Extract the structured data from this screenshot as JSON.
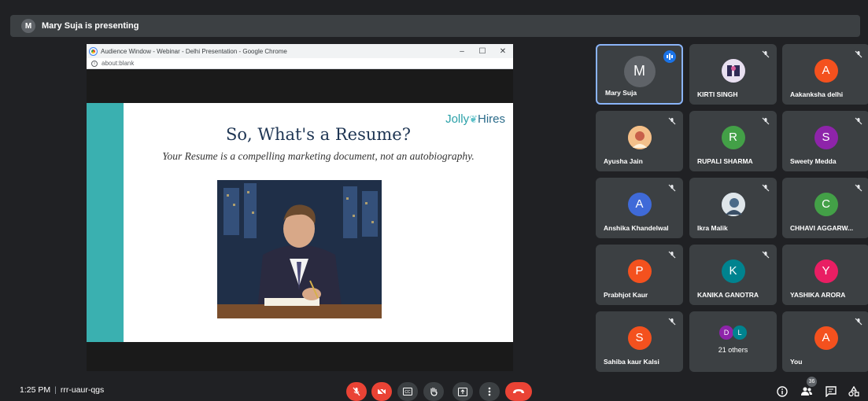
{
  "presenting": {
    "initial": "M",
    "text": "Mary Suja is presenting"
  },
  "browser": {
    "title": "Audience Window - Webinar - Delhi Presentation - Google Chrome",
    "address": "about:blank",
    "minimize": "–",
    "maximize": "☐",
    "close": "✕"
  },
  "slide": {
    "brand_jolly": "Jolly",
    "brand_hires": "Hires",
    "title": "So, What's a Resume?",
    "subtitle": "Your Resume is a compelling marketing document, not an autobiography."
  },
  "participants": [
    {
      "name": "Mary Suja",
      "initial": "M",
      "color": "#5f6368"
    },
    {
      "name": "KIRTI SINGH",
      "initial": "",
      "color": "#7a5c8f"
    },
    {
      "name": "Aakanksha delhi",
      "initial": "A",
      "color": "#f4511e"
    },
    {
      "name": "Ayusha Jain",
      "initial": "",
      "color": "#e08a3c"
    },
    {
      "name": "RUPALI SHARMA",
      "initial": "R",
      "color": "#43a047"
    },
    {
      "name": "Sweety Medda",
      "initial": "S",
      "color": "#8e24aa"
    },
    {
      "name": "Anshika Khandelwal",
      "initial": "A",
      "color": "#3f6ad8"
    },
    {
      "name": "Ikra Malik",
      "initial": "",
      "color": "#6a8ca8"
    },
    {
      "name": "CHHAVI AGGARW...",
      "initial": "C",
      "color": "#43a047"
    },
    {
      "name": "Prabhjot Kaur",
      "initial": "P",
      "color": "#f4511e"
    },
    {
      "name": "KANIKA GANOTRA",
      "initial": "K",
      "color": "#00838f"
    },
    {
      "name": "YASHIKA ARORA",
      "initial": "Y",
      "color": "#e91e63"
    },
    {
      "name": "Sahiba kaur Kalsi",
      "initial": "S",
      "color": "#f4511e"
    },
    {
      "name": "You",
      "initial": "A",
      "color": "#f4511e"
    }
  ],
  "others": {
    "label": "21 others",
    "a": "D",
    "b": "L",
    "a_color": "#8e24aa",
    "b_color": "#00838f"
  },
  "meeting": {
    "time": "1:25 PM",
    "separator": "|",
    "code": "rrr-uaur-qgs"
  },
  "people_count": "36",
  "icons": {
    "mic": "mic-off-icon",
    "cam": "camera-off-icon",
    "cc": "captions-icon",
    "hand": "raise-hand-icon",
    "present": "present-icon",
    "more": "more-vert-icon",
    "end": "end-call-icon",
    "info": "info-icon",
    "people": "people-icon",
    "chat": "chat-icon",
    "activities": "activities-icon"
  }
}
